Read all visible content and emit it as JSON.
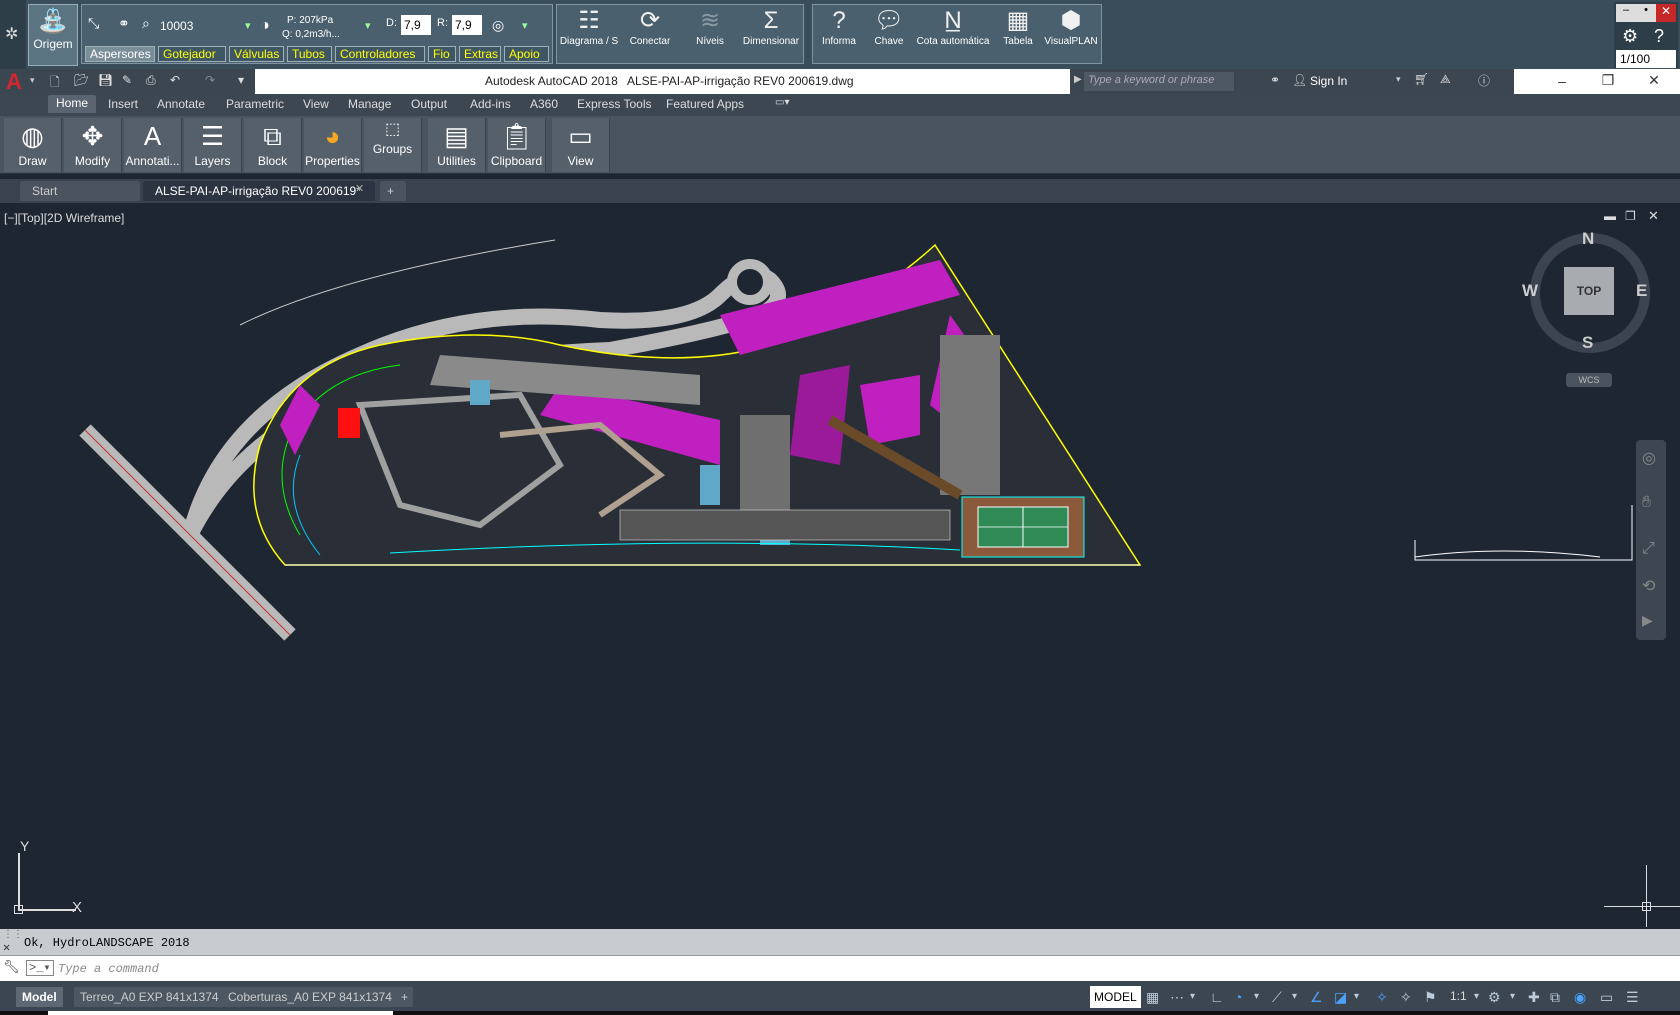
{
  "plugin": {
    "origem_label": "Origem",
    "aspersores_value": "10003",
    "pressure": "P: 207kPa",
    "flow": "Q: 0,2m3/h...",
    "d_label": "D:",
    "d_value": "7,9",
    "r_label": "R:",
    "r_value": "7,9",
    "group_labels": [
      "Aspersores",
      "Gotejador",
      "Válvulas",
      "Tubos",
      "Controladores",
      "Fio",
      "Extras",
      "Apoio"
    ],
    "buttons": [
      "Diagrama / S",
      "Conectar",
      "Níveis",
      "Dimensionar",
      "Informa",
      "Chave",
      "Cota automática",
      "Tabela",
      "VisualPLAN"
    ],
    "scale": "1/100"
  },
  "title": {
    "app": "Autodesk AutoCAD 2018",
    "file": "ALSE-PAI-AP-irrigação REV0 200619.dwg",
    "search_placeholder": "Type a keyword or phrase",
    "sign_in": "Sign In"
  },
  "ribbon_tabs": [
    "Home",
    "Insert",
    "Annotate",
    "Parametric",
    "View",
    "Manage",
    "Output",
    "Add-ins",
    "A360",
    "Express Tools",
    "Featured Apps"
  ],
  "ribbon_panels": [
    "Draw",
    "Modify",
    "Annotati...",
    "Layers",
    "Block",
    "Properties",
    "Groups",
    "Utilities",
    "Clipboard",
    "View"
  ],
  "file_tabs": {
    "start": "Start",
    "current": "ALSE-PAI-AP-irrigação REV0 200619*"
  },
  "viewport": {
    "label": "[−][Top][2D Wireframe]",
    "compass": {
      "n": "N",
      "s": "S",
      "e": "E",
      "w": "W",
      "top": "TOP",
      "wcs": "WCS"
    },
    "ucs": {
      "x": "X",
      "y": "Y"
    }
  },
  "command": {
    "history": "Ok, HydroLANDSCAPE 2018",
    "placeholder": "Type a command"
  },
  "layout_tabs": [
    "Model",
    "Terreo_A0 EXP 841x1374",
    "Coberturas_A0 EXP 841x1374"
  ],
  "status": {
    "model": "MODEL",
    "scale": "1:1"
  }
}
